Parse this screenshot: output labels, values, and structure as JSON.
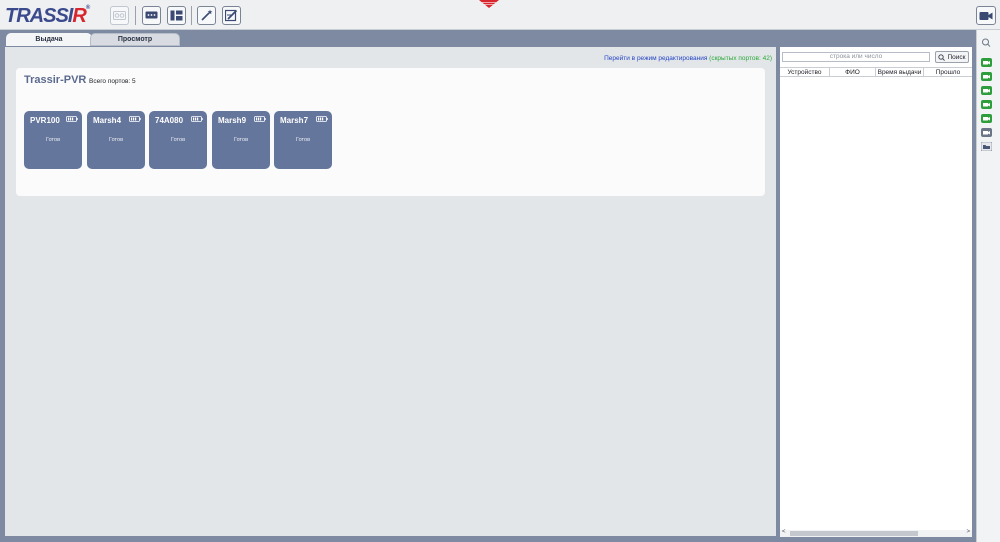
{
  "app": {
    "logo_text": "TRASSIR",
    "brand_color": "#3b4a8c",
    "accent_red": "#d8262e"
  },
  "toolbar": {
    "buttons": [
      {
        "icon": "tape-icon",
        "disabled": true
      },
      {
        "icon": "chat-icon",
        "disabled": false
      },
      {
        "icon": "layout-icon",
        "disabled": false
      },
      {
        "icon": "magic-wand-icon",
        "disabled": false
      },
      {
        "icon": "edit-icon",
        "disabled": false
      }
    ],
    "right_button_icon": "video-camera-icon"
  },
  "tabs": {
    "active": "Выдача",
    "inactive": "Просмотр"
  },
  "edit_mode": {
    "link_text": "Перейти в режим редактирования",
    "hidden_ports_text": "(скрытых портов: 42)"
  },
  "panel": {
    "title": "Trassir-PVR",
    "total_ports": "Всего портов: 5"
  },
  "devices": [
    {
      "name": "PVR100",
      "status": "Готов",
      "battery_icon": "battery-icon"
    },
    {
      "name": "Marsh4",
      "status": "Готов",
      "battery_icon": "battery-icon"
    },
    {
      "name": "74A080",
      "status": "Готов",
      "battery_icon": "battery-icon"
    },
    {
      "name": "Marsh9",
      "status": "Готов",
      "battery_icon": "battery-icon"
    },
    {
      "name": "Marsh7",
      "status": "Готов",
      "battery_icon": "battery-icon"
    }
  ],
  "side_panel": {
    "search_placeholder": "строка или число",
    "search_button": "Поиск",
    "columns": [
      "Устройство",
      "ФИО",
      "Время выдачи",
      "Прошло"
    ]
  },
  "right_column": {
    "icons": [
      "search-icon",
      "camera-green-icon",
      "camera-green-icon",
      "camera-green-icon",
      "camera-green-icon",
      "camera-green-icon",
      "camera-gray-icon",
      "folder-icon"
    ]
  },
  "colors": {
    "device_tile": "#65769c",
    "frame": "#7d8aa2",
    "link_blue": "#2343c7",
    "hidden_green": "#28a83a",
    "status_green": "#2e9e3c"
  }
}
